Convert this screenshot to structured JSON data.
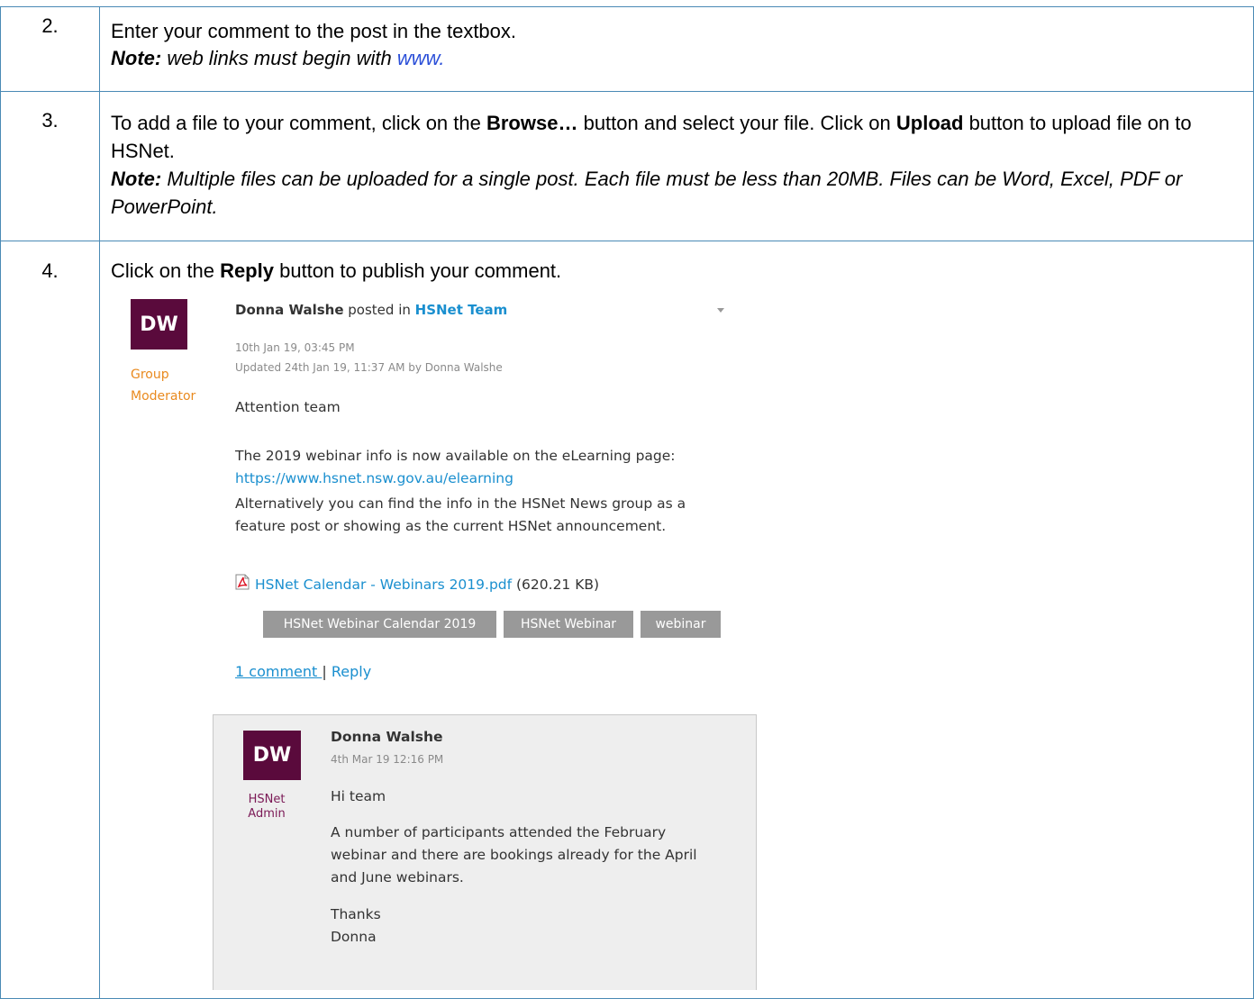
{
  "rows": [
    {
      "number": "2.",
      "text": "Enter your comment to the post in the textbox.",
      "note_label": "Note:",
      "note_text": " web links must begin with ",
      "note_link": "www."
    },
    {
      "number": "3.",
      "text_a": "To add a file to your comment, click on the ",
      "browse": "Browse…",
      "text_b": " button and select your file.  Click on ",
      "upload": "Upload",
      "text_c": " button to upload file on to HSNet.",
      "note_label": "Note:",
      "note_text": " Multiple files can be uploaded for a single post.  Each file must be less than 20MB.  Files can be Word, Excel, PDF or PowerPoint."
    },
    {
      "number": "4.",
      "text_a": "Click on the ",
      "reply": "Reply",
      "text_b": " button to publish your comment."
    }
  ],
  "post": {
    "avatar": "DW",
    "role_line1": "Group",
    "role_line2": "Moderator",
    "author": "Donna Walshe",
    "posted_in": " posted in ",
    "group": "HSNet Team",
    "date": "10th Jan 19, 03:45 PM",
    "updated": "Updated 24th Jan 19, 11:37 AM by Donna Walshe",
    "para1": "Attention team",
    "para2": "The 2019 webinar info is now available on the eLearning page:",
    "para2_link": "https://www.hsnet.nsw.gov.au/elearning",
    "para3": "Alternatively you can find the info in the HSNet News group as a feature post or showing as the current HSNet announcement.",
    "attachment_name": "HSNet Calendar - Webinars 2019.pdf",
    "attachment_size": " (620.21 KB)",
    "tags": [
      "HSNet Webinar Calendar 2019",
      "HSNet Webinar",
      "webinar"
    ],
    "comments_link": "1 comment ",
    "separator": "| ",
    "reply_link": "Reply"
  },
  "comment": {
    "avatar": "DW",
    "role_line1": "HSNet",
    "role_line2": "Admin",
    "author": "Donna Walshe",
    "date": "4th Mar 19 12:16 PM",
    "para1": "Hi team",
    "para2": "A number of participants attended the February webinar and there are bookings already for the April and June webinars.",
    "para3_line1": "Thanks",
    "para3_line2": "Donna"
  },
  "colors": {
    "border": "#4a8ab5",
    "avatar": "#5a0a3c",
    "link": "#1a8fcf",
    "note_link": "#2b4fd8",
    "tag_bg": "#999999",
    "moderator": "#e98a1f",
    "admin": "#7b1956"
  },
  "icons": [
    "pdf-icon",
    "caret-down-icon"
  ]
}
